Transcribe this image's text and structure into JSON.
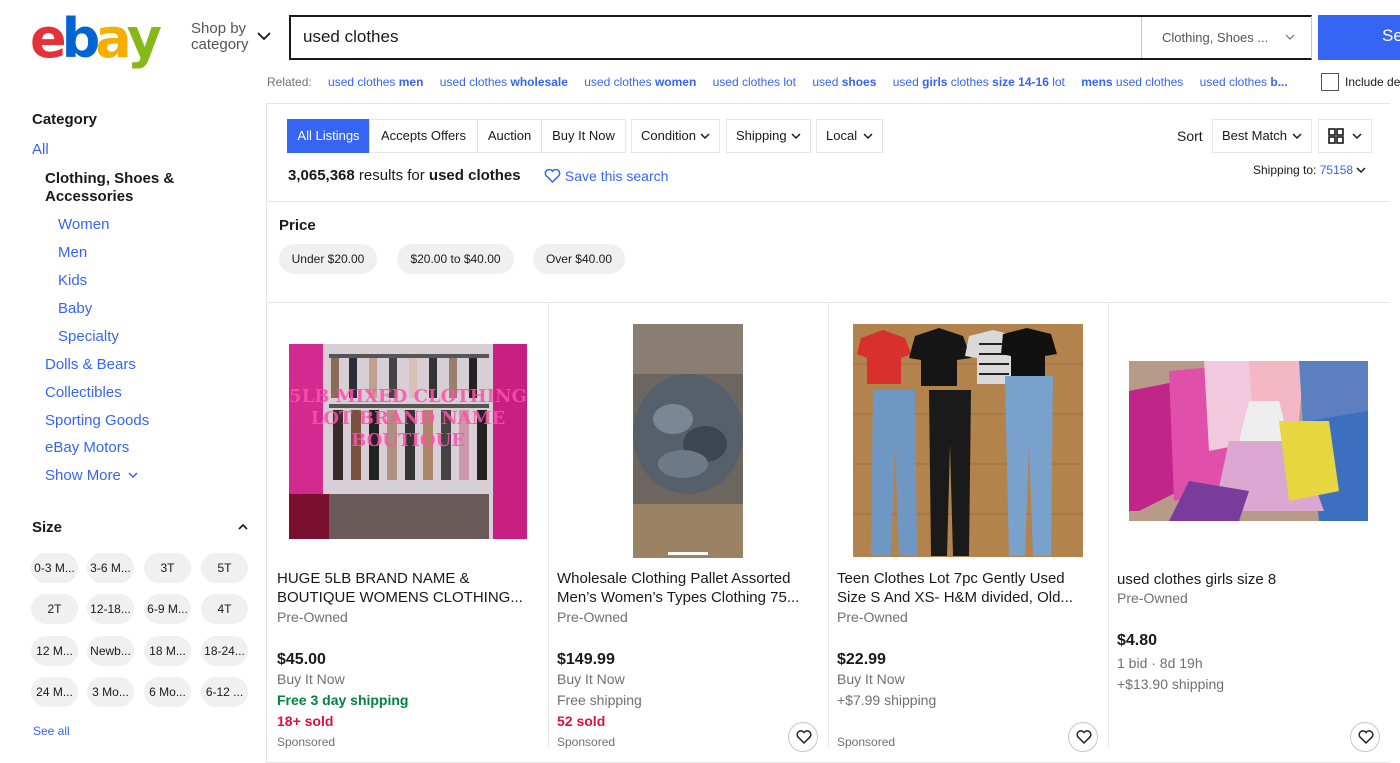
{
  "header": {
    "logo_letters": [
      "e",
      "b",
      "a",
      "y"
    ],
    "logo_colors": [
      "#e53238",
      "#0064d2",
      "#f5af02",
      "#86b817"
    ],
    "shop_by_line1": "Shop by",
    "shop_by_line2": "category",
    "search_value": "used clothes",
    "category_select": "Clothing, Shoes ...",
    "search_button": "Se"
  },
  "related": {
    "label": "Related:",
    "items": [
      {
        "pre": "used clothes ",
        "bold": "men",
        "post": ""
      },
      {
        "pre": "used clothes ",
        "bold": "wholesale",
        "post": ""
      },
      {
        "pre": "used clothes ",
        "bold": "women",
        "post": ""
      },
      {
        "pre": "used clothes lot",
        "bold": "",
        "post": ""
      },
      {
        "pre": "used ",
        "bold": "shoes",
        "post": ""
      },
      {
        "pre": "used ",
        "bold": "girls",
        "post": " clothes "
      },
      {
        "pre": "",
        "bold": "mens",
        "post": " used clothes"
      },
      {
        "pre": "used clothes ",
        "bold": "b...",
        "post": ""
      }
    ],
    "item6_extra_bold": "size 14-16",
    "item6_tail": " lot",
    "include_label": "Include de"
  },
  "sidebar": {
    "category_heading": "Category",
    "all": "All",
    "current_line1": "Clothing, Shoes &",
    "current_line2": "Accessories",
    "subcategories": [
      "Women",
      "Men",
      "Kids",
      "Baby",
      "Specialty"
    ],
    "other_categories": [
      "Dolls & Bears",
      "Collectibles",
      "Sporting Goods",
      "eBay Motors"
    ],
    "show_more": "Show More",
    "size_heading": "Size",
    "sizes": [
      "0-3 M...",
      "3-6 M...",
      "3T",
      "5T",
      "2T",
      "12-18...",
      "6-9 M...",
      "4T",
      "12 M...",
      "Newb...",
      "18 M...",
      "18-24...",
      "24 M...",
      "3 Mo...",
      "6 Mo...",
      "6-12 ..."
    ],
    "see_all": "See all"
  },
  "filters": {
    "tabs": [
      "All Listings",
      "Accepts Offers",
      "Auction",
      "Buy It Now"
    ],
    "dropdowns": [
      "Condition",
      "Shipping",
      "Local"
    ],
    "sort_label": "Sort",
    "sort_value": "Best Match",
    "results_count": "3,065,368",
    "results_mid": " results for ",
    "results_query": "used clothes",
    "save_search": "Save this search",
    "shipping_to_label": "Shipping to:",
    "shipping_zip": "75158"
  },
  "price_filter": {
    "heading": "Price",
    "options": [
      "Under $20.00",
      "$20.00 to $40.00",
      "Over $40.00"
    ]
  },
  "products": [
    {
      "title1": "HUGE 5LB BRAND NAME &",
      "title2": "BOUTIQUE WOMENS CLOTHING...",
      "condition": "Pre-Owned",
      "price": "$45.00",
      "format": "Buy It Now",
      "shipping": "Free 3 day shipping",
      "sold": "18+ sold",
      "sponsored": "Sponsored",
      "image_text": "5LB MIXED CLOTHING LOT BRAND NAME BOUTIQUE"
    },
    {
      "title1": "Wholesale Clothing Pallet Assorted",
      "title2": "Men’s Women’s Types Clothing 75...",
      "condition": "Pre-Owned",
      "price": "$149.99",
      "format": "Buy It Now",
      "shipping": "Free shipping",
      "sold": "52 sold",
      "sponsored": "Sponsored"
    },
    {
      "title1": "Teen Clothes Lot 7pc Gently Used",
      "title2": "Size S And XS- H&M divided, Old...",
      "condition": "Pre-Owned",
      "price": "$22.99",
      "format": "Buy It Now",
      "shipping": "+$7.99 shipping",
      "sponsored": "Sponsored"
    },
    {
      "title1": "used clothes girls size 8",
      "condition": "Pre-Owned",
      "price": "$4.80",
      "bids": "1 bid · 8d 19h",
      "shipping": "+$13.90 shipping"
    }
  ],
  "colors": {
    "accent": "#3665f3",
    "green": "#05823f",
    "red": "#e0103a"
  }
}
